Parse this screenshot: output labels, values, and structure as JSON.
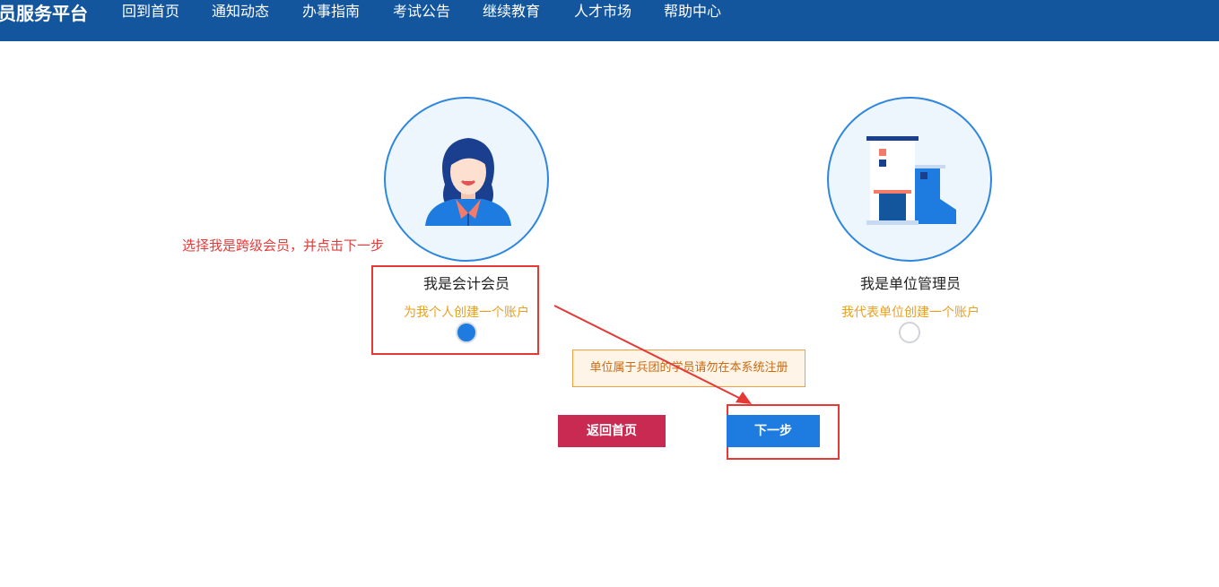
{
  "header": {
    "brand": "员服务平台",
    "nav": [
      "回到首页",
      "通知动态",
      "办事指南",
      "考试公告",
      "继续教育",
      "人才市场",
      "帮助中心"
    ]
  },
  "roles": {
    "member": {
      "title": "我是会计会员",
      "subtitle": "为我个人创建一个账户",
      "selected": true
    },
    "unit": {
      "title": "我是单位管理员",
      "subtitle": "我代表单位创建一个账户",
      "selected": false
    }
  },
  "annotation": {
    "text": "选择我是跨级会员，并点击下一步"
  },
  "notice": {
    "text": "单位属于兵团的学员请勿在本系统注册"
  },
  "buttons": {
    "back": "返回首页",
    "next": "下一步"
  },
  "colors": {
    "header": "#13569e",
    "accent": "#1e7be0",
    "back_button": "#c92a52",
    "annotation": "#e43c3c",
    "subtitle": "#e8a020"
  },
  "icons": {
    "member": "woman-avatar-icon",
    "unit": "building-icon"
  }
}
